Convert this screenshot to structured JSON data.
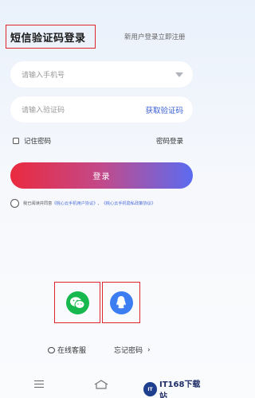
{
  "header": {
    "title": "短信验证码登录",
    "register_link": "新用户登录立即注册"
  },
  "form": {
    "phone_placeholder": "请输入手机号",
    "code_placeholder": "请输入验证码",
    "get_code_label": "获取验证码",
    "remember_label": "记住密码",
    "password_login_label": "密码登录",
    "login_button": "登录"
  },
  "agreement": {
    "prefix": "我已阅读并同意",
    "user_agreement": "《桃心云手机用户协议》",
    "separator": "、",
    "privacy_policy": "《桃心云手机隐私政策协议》"
  },
  "social": [
    {
      "name": "wechat-icon",
      "color": "#17b94e"
    },
    {
      "name": "qq-icon",
      "color": "#3d7df2"
    }
  ],
  "footer": {
    "service_label": "在线客服",
    "forgot_label": "忘记密码",
    "forgot_chevron": "›"
  },
  "watermark": {
    "mark": "IT",
    "text": "IT168下载站"
  },
  "colors": {
    "accent_red": "#e0242f",
    "link_blue": "#3a5fd6",
    "button_gradient": [
      "#ea2a3f",
      "#c24a8a",
      "#5b6bf0"
    ]
  }
}
